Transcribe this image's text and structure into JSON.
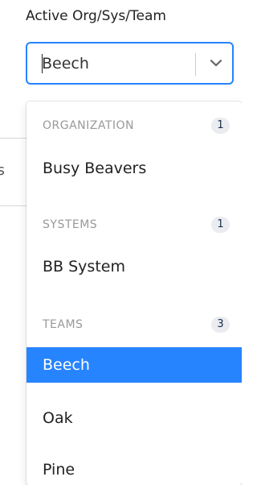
{
  "field": {
    "label": "Active Org/Sys/Team",
    "value": "Beech"
  },
  "background": {
    "partial_text": "nts"
  },
  "menu": {
    "groups": [
      {
        "title": "ORGANIZATION",
        "count": "1",
        "options": [
          "Busy Beavers"
        ]
      },
      {
        "title": "SYSTEMS",
        "count": "1",
        "options": [
          "BB System"
        ]
      },
      {
        "title": "TEAMS",
        "count": "3",
        "options": [
          "Beech",
          "Oak",
          "Pine"
        ]
      }
    ],
    "selected": "Beech"
  },
  "colors": {
    "accent": "#2684ff",
    "count_badge_bg": "#ebecf0",
    "group_title": "#999999"
  },
  "icons": {
    "dropdown": "chevron-down-icon"
  }
}
